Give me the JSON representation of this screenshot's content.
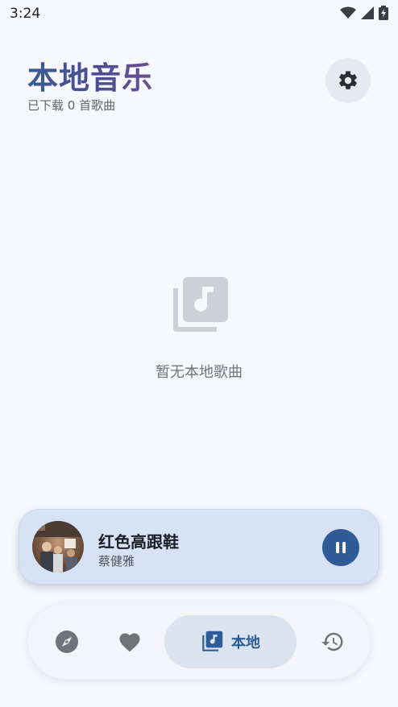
{
  "status_bar": {
    "time": "3:24"
  },
  "header": {
    "title": "本地音乐",
    "subtitle": "已下载 0 首歌曲"
  },
  "empty_state": {
    "message": "暂无本地歌曲"
  },
  "player": {
    "title": "红色高跟鞋",
    "artist": "蔡健雅",
    "state": "playing"
  },
  "nav": {
    "items": [
      {
        "icon": "compass-icon"
      },
      {
        "icon": "heart-icon"
      },
      {
        "icon": "library-music-icon",
        "label": "本地",
        "active": true
      },
      {
        "icon": "history-icon"
      }
    ]
  },
  "colors": {
    "accent": "#2f5c97",
    "player_bg": "#d8e2f5",
    "nav_active_bg": "#dbe3ef"
  }
}
